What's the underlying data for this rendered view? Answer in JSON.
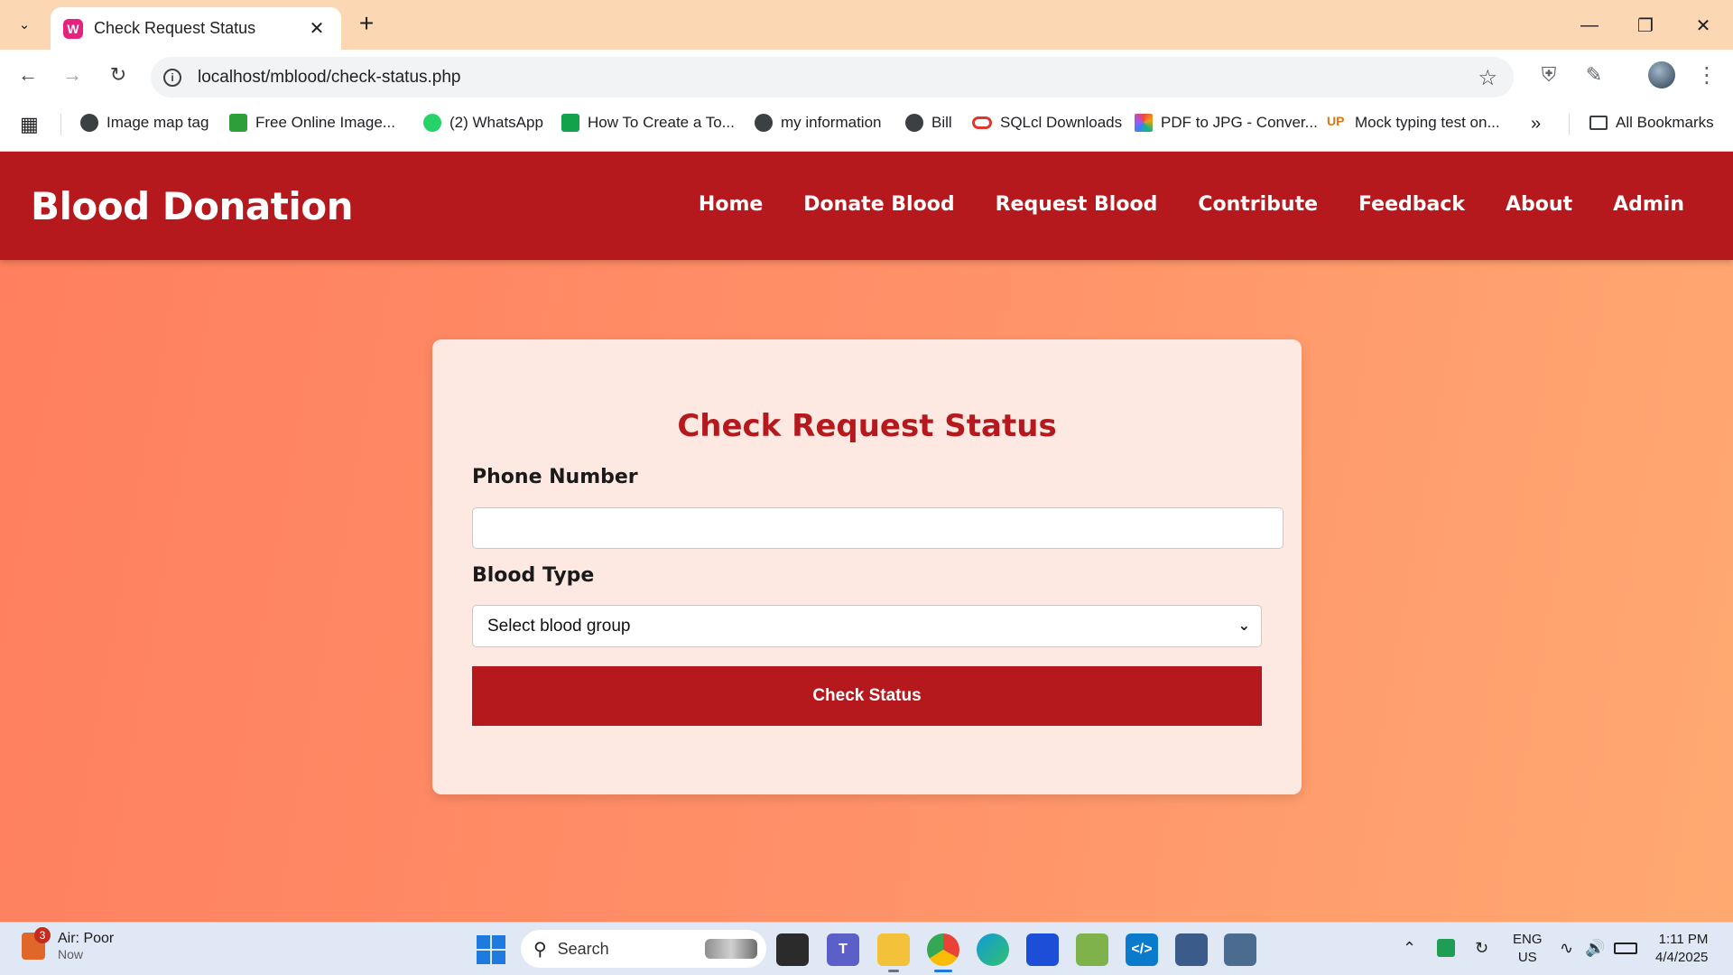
{
  "browser": {
    "tab_title": "Check Request Status",
    "tab_favicon_letter": "W",
    "url": "localhost/mblood/check-status.php",
    "bookmarks": [
      {
        "label": "Image map tag",
        "icon": "globe-icon",
        "color": "#3c4043"
      },
      {
        "label": "Free Online Image...",
        "icon": "image-icon",
        "color": "#2e9e3b"
      },
      {
        "label": "(2) WhatsApp",
        "icon": "whatsapp-icon",
        "color": "#25d366"
      },
      {
        "label": "How To Create a To...",
        "icon": "w-icon",
        "color": "#12a34a"
      },
      {
        "label": "my information",
        "icon": "globe-icon",
        "color": "#3c4043"
      },
      {
        "label": "Bill",
        "icon": "globe-icon",
        "color": "#3c4043"
      },
      {
        "label": "SQLcl Downloads",
        "icon": "oracle-icon",
        "color": "#e2362c"
      },
      {
        "label": "PDF to JPG - Conver...",
        "icon": "pdf-icon",
        "color": "#f59e0b"
      },
      {
        "label": "Mock typing test on...",
        "icon": "up-icon",
        "color": "#e8730c"
      }
    ],
    "all_bookmarks_label": "All Bookmarks"
  },
  "site": {
    "brand": "Blood Donation",
    "nav": [
      "Home",
      "Donate Blood",
      "Request Blood",
      "Contribute",
      "Feedback",
      "About",
      "Admin"
    ]
  },
  "form": {
    "title": "Check Request Status",
    "phone_label": "Phone Number",
    "phone_value": "",
    "blood_type_label": "Blood Type",
    "blood_type_selected": "Select blood group",
    "submit_label": "Check Status"
  },
  "taskbar": {
    "weather_title": "Air: Poor",
    "weather_sub": "Now",
    "weather_badge": "3",
    "search_placeholder": "Search",
    "lang_line1": "ENG",
    "lang_line2": "US",
    "time": "1:11 PM",
    "date": "4/4/2025"
  },
  "colors": {
    "brand_red": "#b5191d",
    "card_bg": "#fde9e2",
    "tabbar_bg": "#fbd7b4"
  }
}
